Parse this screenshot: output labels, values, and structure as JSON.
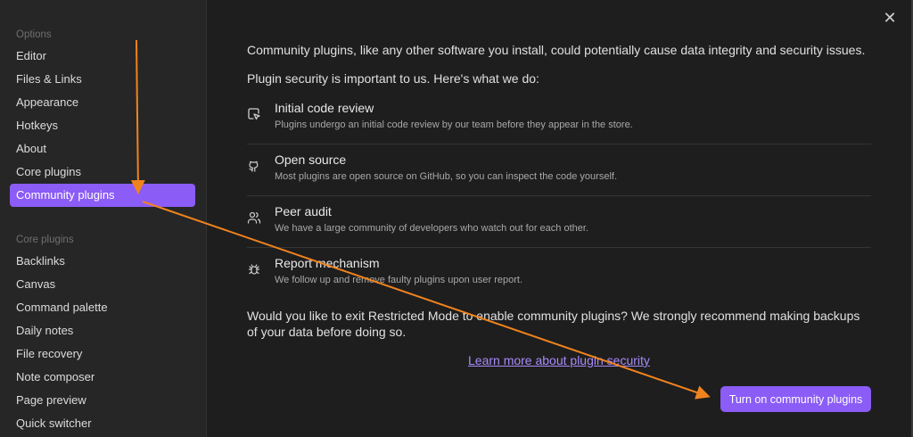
{
  "sidebar": {
    "options_label": "Options",
    "options_items": [
      {
        "label": "Editor"
      },
      {
        "label": "Files & Links"
      },
      {
        "label": "Appearance"
      },
      {
        "label": "Hotkeys"
      },
      {
        "label": "About"
      },
      {
        "label": "Core plugins"
      },
      {
        "label": "Community plugins",
        "active": true
      }
    ],
    "core_label": "Core plugins",
    "core_items": [
      {
        "label": "Backlinks"
      },
      {
        "label": "Canvas"
      },
      {
        "label": "Command palette"
      },
      {
        "label": "Daily notes"
      },
      {
        "label": "File recovery"
      },
      {
        "label": "Note composer"
      },
      {
        "label": "Page preview"
      },
      {
        "label": "Quick switcher"
      }
    ]
  },
  "main": {
    "close_glyph": "✕",
    "intro": "Community plugins, like any other software you install, could potentially cause data integrity and security issues.",
    "security_heading": "Plugin security is important to us. Here's what we do:",
    "features": [
      {
        "icon": "code-review-icon",
        "title": "Initial code review",
        "desc": "Plugins undergo an initial code review by our team before they appear in the store."
      },
      {
        "icon": "github-icon",
        "title": "Open source",
        "desc": "Most plugins are open source on GitHub, so you can inspect the code yourself."
      },
      {
        "icon": "users-icon",
        "title": "Peer audit",
        "desc": "We have a large community of developers who watch out for each other."
      },
      {
        "icon": "bug-icon",
        "title": "Report mechanism",
        "desc": "We follow up and remove faulty plugins upon user report."
      }
    ],
    "restricted_prompt": "Would you like to exit Restricted Mode to enable community plugins? We strongly recommend making backups of your data before doing so.",
    "learn_more": "Learn more about plugin security",
    "turn_on_button": "Turn on community plugins"
  },
  "colors": {
    "accent": "#8b5cf6",
    "link": "#a78bfa",
    "annotation_arrow": "#f0831e"
  }
}
